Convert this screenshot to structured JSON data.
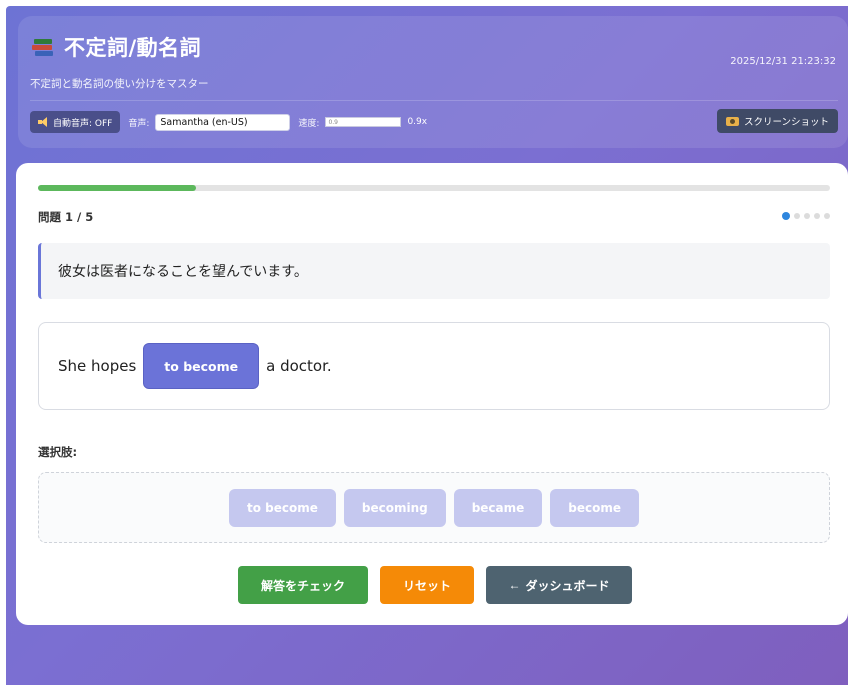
{
  "header": {
    "title": "不定詞/動名詞",
    "subtitle": "不定詞と動名詞の使い分けをマスター",
    "datetime": "2025/12/31 21:23:32",
    "icons": {
      "title": "books-icon",
      "audio": "speaker-icon",
      "screenshot": "camera-icon"
    }
  },
  "controls": {
    "auto_audio_label": "自動音声: OFF",
    "voice_label": "音声:",
    "voice_value": "Samantha (en-US)",
    "speed_label": "速度:",
    "speed_input": "0.9",
    "speed_value": "0.9x",
    "screenshot_label": "スクリーンショット"
  },
  "quiz": {
    "progress": 0.2,
    "counter": "問題 1 / 5",
    "total_dots": 5,
    "current_dot": 1,
    "prompt": "彼女は医者になることを望んでいます。",
    "sentence_before": "She hopes",
    "placed_answer": "to become",
    "sentence_after": "a doctor.",
    "options_label": "選択肢:",
    "options": [
      "to become",
      "becoming",
      "became",
      "become"
    ]
  },
  "actions": {
    "check_label": "解答をチェック",
    "reset_label": "リセット",
    "dashboard_label": "ダッシュボード",
    "dashboard_arrow": "←"
  },
  "colors": {
    "accent": "#6b73d8",
    "progress": "#5cb85c",
    "check": "#43a047",
    "reset": "#f58a07",
    "dashboard": "#4e6370"
  }
}
